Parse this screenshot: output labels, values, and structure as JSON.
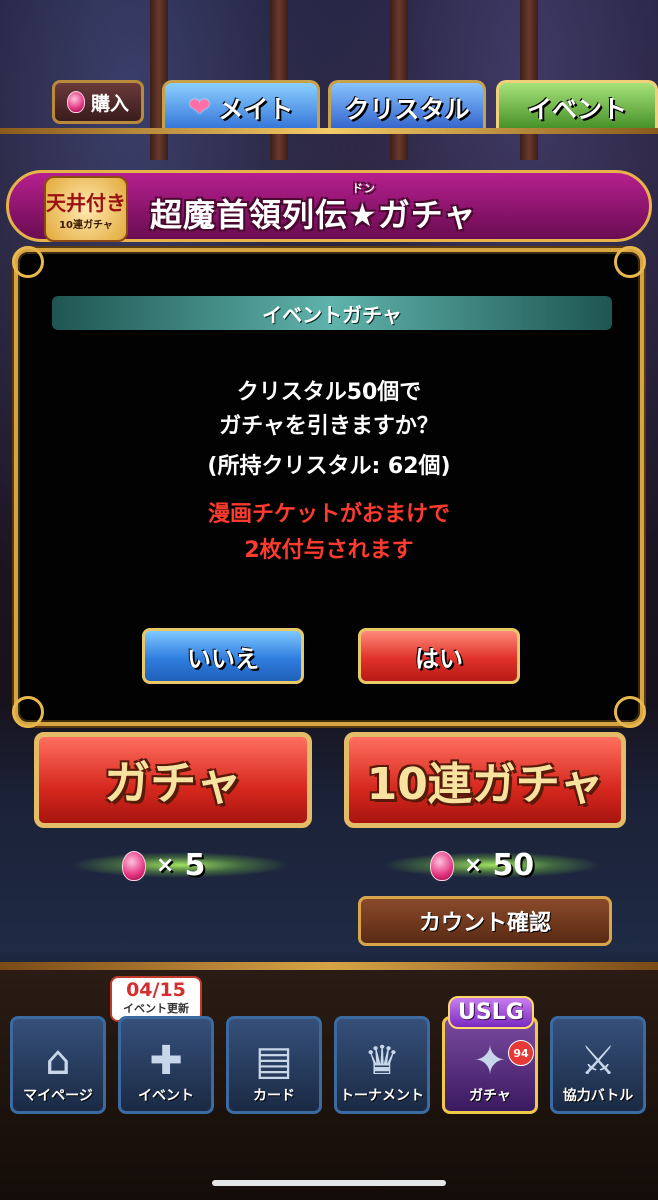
{
  "top_tabs": {
    "buy_label": "購入",
    "tabs": [
      {
        "label": "メイト",
        "icon": "heart-icon"
      },
      {
        "label": "クリスタル"
      },
      {
        "label": "イベント",
        "selected": true
      }
    ]
  },
  "banner": {
    "badge_line1": "天井付き",
    "badge_line2": "10連ガチャ",
    "title": "超魔首領列伝★ガチャ",
    "ruby": "ドン"
  },
  "dialog": {
    "title": "イベントガチャ",
    "line1": "クリスタル50個で",
    "line2": "ガチャを引きますか？",
    "line3": "(所持クリスタル: 62個)",
    "bonus_line1": "漫画チケットがおまけで",
    "bonus_line2": "2枚付与されます",
    "no_label": "いいえ",
    "yes_label": "はい"
  },
  "gacha": {
    "single_label": "ガチャ",
    "single_cost": "5",
    "ten_label": "10連ガチャ",
    "ten_cost": "50",
    "multiply": "×",
    "count_label": "カウント確認"
  },
  "event_badge": {
    "date": "04/15",
    "text": "イベント更新"
  },
  "nav": {
    "items": [
      {
        "label": "マイページ",
        "icon": "house-icon"
      },
      {
        "label": "イベント",
        "icon": "event-icon"
      },
      {
        "label": "カード",
        "icon": "cards-icon"
      },
      {
        "label": "トーナメント",
        "icon": "trophy-icon"
      },
      {
        "label": "ガチャ",
        "icon": "gacha-icon",
        "active": true
      },
      {
        "label": "協力バトル",
        "icon": "battle-icon"
      }
    ],
    "gacha_tag": "USLG",
    "gacha_count": "94"
  },
  "colors": {
    "accent_gold": "#d6a440",
    "bonus_red": "#ff3b2f",
    "no_blue": "#2f7ee0",
    "yes_red": "#e0322a"
  }
}
